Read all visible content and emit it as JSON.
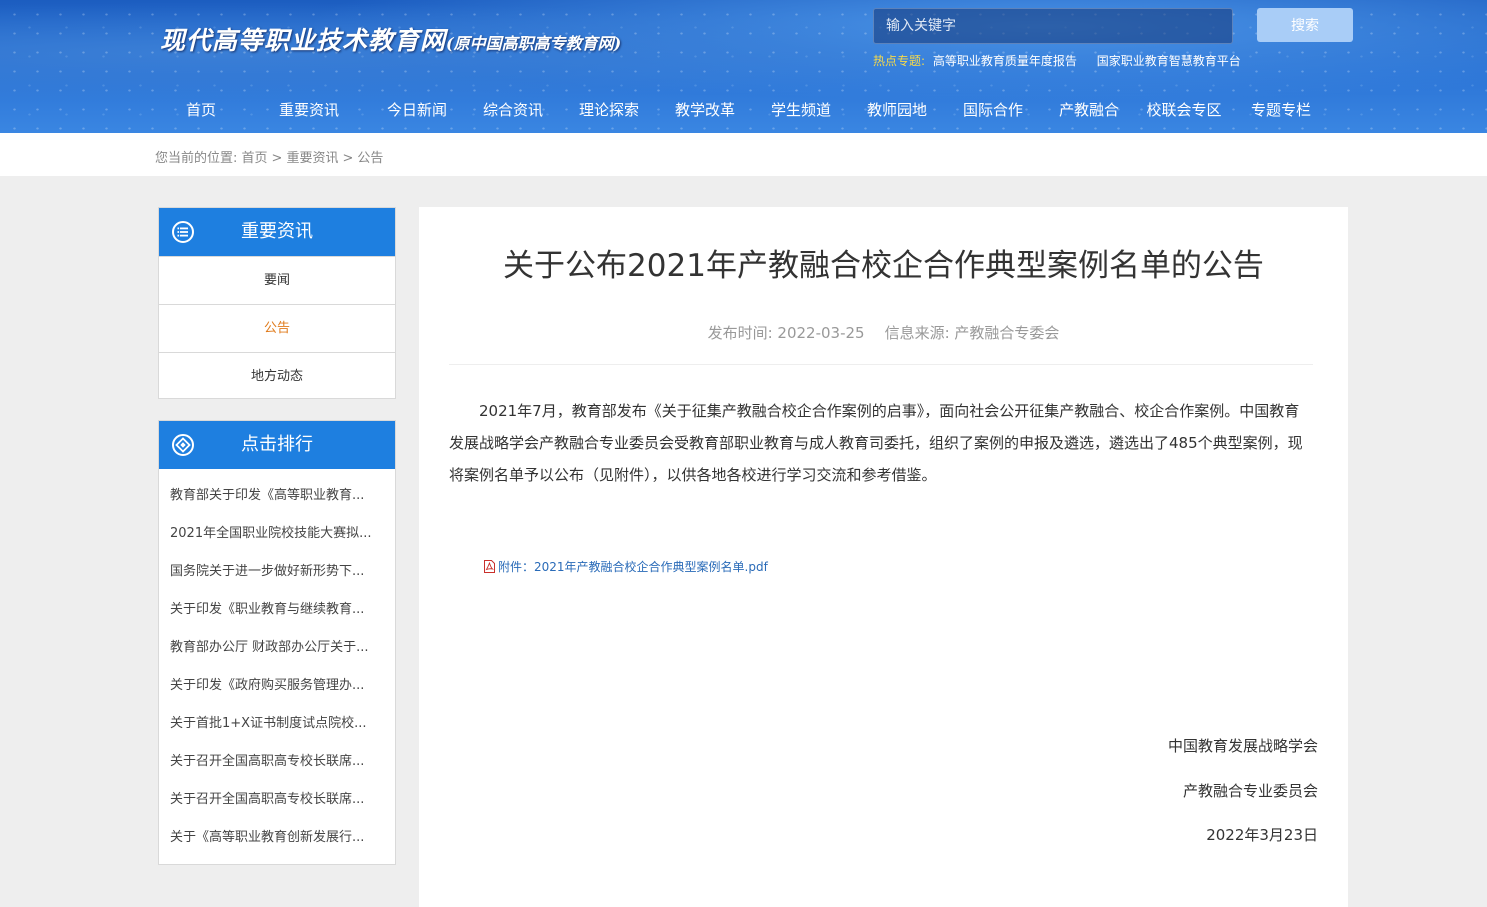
{
  "header": {
    "logo_main": "现代高等职业技术教育网",
    "logo_sub": "(原中国高职高专教育网)",
    "search": {
      "placeholder": "输入关键字",
      "button_label": "搜索"
    },
    "hot": {
      "label": "热点专题:",
      "links": [
        "高等职业教育质量年度报告",
        "国家职业教育智慧教育平台"
      ],
      "label_color": "#f5d94a"
    },
    "nav": [
      "首页",
      "重要资讯",
      "今日新闻",
      "综合资讯",
      "理论探索",
      "教学改革",
      "学生频道",
      "教师园地",
      "国际合作",
      "产教融合",
      "校联会专区",
      "专题专栏"
    ]
  },
  "breadcrumb": {
    "prefix": "您当前的位置:",
    "items": [
      "首页",
      "重要资讯",
      "公告"
    ],
    "separator": ">"
  },
  "sidebar": {
    "section1": {
      "title": "重要资讯",
      "icon": "list-icon",
      "items": [
        {
          "label": "要闻",
          "active": false
        },
        {
          "label": "公告",
          "active": true
        },
        {
          "label": "地方动态",
          "active": false
        }
      ]
    },
    "section2": {
      "title": "点击排行",
      "icon": "diamond-icon",
      "items": [
        "教育部关于印发《高等职业教育...",
        "2021年全国职业院校技能大赛拟...",
        "国务院关于进一步做好新形势下...",
        "关于印发《职业教育与继续教育...",
        "教育部办公厅 财政部办公厅关于...",
        "关于印发《政府购买服务管理办...",
        "关于首批1+X证书制度试点院校...",
        "关于召开全国高职高专校长联席...",
        "关于召开全国高职高专校长联席...",
        "关于《高等职业教育创新发展行..."
      ]
    },
    "accent_color": "#1e7fe0",
    "active_color": "#e07b1c"
  },
  "article": {
    "title": "关于公布2021年产教融合校企合作典型案例名单的公告",
    "meta": {
      "date_label": "发布时间: 2022-03-25",
      "source_label": "信息来源: 产教融合专委会"
    },
    "body": "2021年7月，教育部发布《关于征集产教融合校企合作案例的启事》，面向社会公开征集产教融合、校企合作案例。中国教育发展战略学会产教融合专业委员会受教育部职业教育与成人教育司委托，组织了案例的申报及遴选，遴选出了485个典型案例，现将案例名单予以公布（见附件），以供各地各校进行学习交流和参考借鉴。",
    "attachment": "附件：2021年产教融合校企合作典型案例名单.pdf",
    "signature": [
      "中国教育发展战略学会",
      "产教融合专业委员会",
      "2022年3月23日"
    ]
  }
}
